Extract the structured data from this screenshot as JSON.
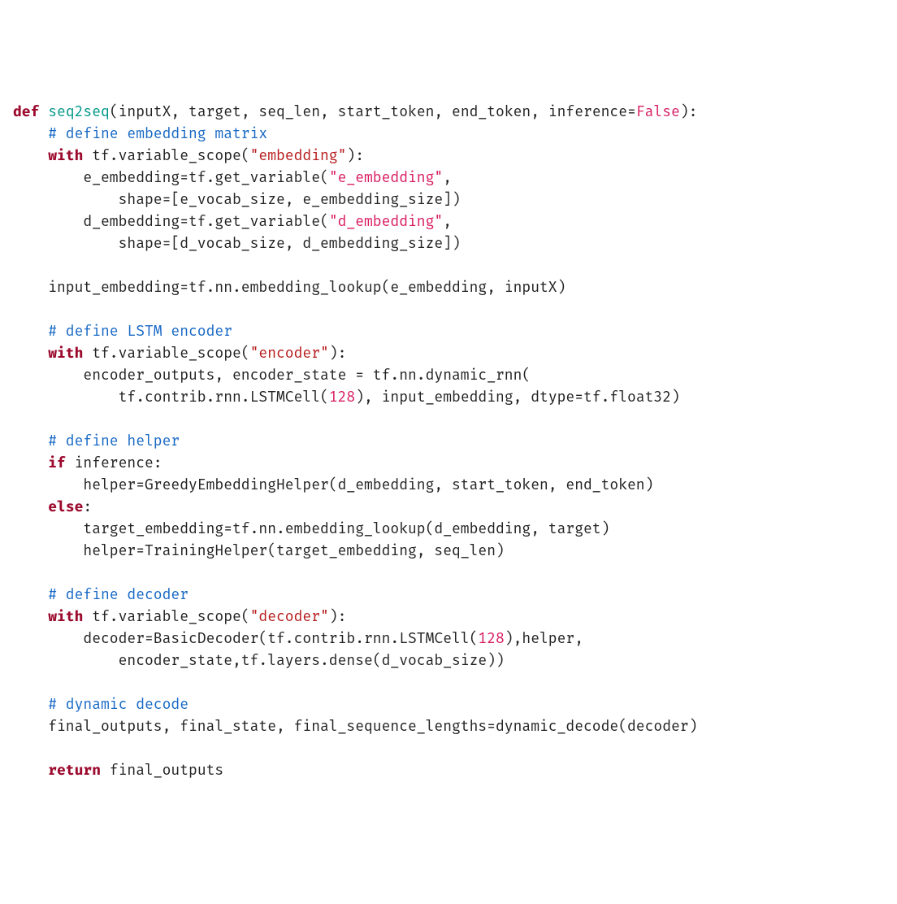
{
  "code": {
    "l01_def": "def",
    "l01_fn": "seq2seq",
    "l01_args": "(inputX, target, seq_len, start_token, end_token, inference=",
    "l01_false": "False",
    "l01_end": "):",
    "l02_cmt": "# define embedding matrix",
    "l03_with": "with",
    "l03_tf": " tf.variable_scope(",
    "l03_str": "\"embedding\"",
    "l03_end": "):",
    "l04": "        e_embedding=tf.get_variable(",
    "l04_str": "\"e_embedding\"",
    "l04_end": ",",
    "l05": "            shape=[e_vocab_size, e_embedding_size])",
    "l06": "        d_embedding=tf.get_variable(",
    "l06_str": "\"d_embedding\"",
    "l06_end": ",",
    "l07": "            shape=[d_vocab_size, d_embedding_size])",
    "l09": "    input_embedding=tf.nn.embedding_lookup(e_embedding, inputX)",
    "l11_cmt": "# define LSTM encoder",
    "l12_with": "with",
    "l12_tf": " tf.variable_scope(",
    "l12_str": "\"encoder\"",
    "l12_end": "):",
    "l13": "        encoder_outputs, encoder_state = tf.nn.dynamic_rnn(",
    "l14a": "            tf.contrib.rnn.LSTMCell(",
    "l14_num": "128",
    "l14b": "), input_embedding, dtype=tf.float32)",
    "l16_cmt": "# define helper",
    "l17_if": "if",
    "l17_rest": " inference:",
    "l18": "        helper=GreedyEmbeddingHelper(d_embedding, start_token, end_token)",
    "l19_else": "else",
    "l19_colon": ":",
    "l20": "        target_embedding=tf.nn.embedding_lookup(d_embedding, target)",
    "l21": "        helper=TrainingHelper(target_embedding, seq_len)",
    "l23_cmt": "# define decoder",
    "l24_with": "with",
    "l24_tf": " tf.variable_scope(",
    "l24_str": "\"decoder\"",
    "l24_end": "):",
    "l25a": "        decoder=BasicDecoder(tf.contrib.rnn.LSTMCell(",
    "l25_num": "128",
    "l25b": "),helper,",
    "l26": "            encoder_state,tf.layers.dense(d_vocab_size))",
    "l28_cmt": "# dynamic decode",
    "l29": "    final_outputs, final_state, final_sequence_lengths=dynamic_decode(decoder)",
    "l31_ret": "return",
    "l31_rest": " final_outputs",
    "indent1": "    "
  }
}
